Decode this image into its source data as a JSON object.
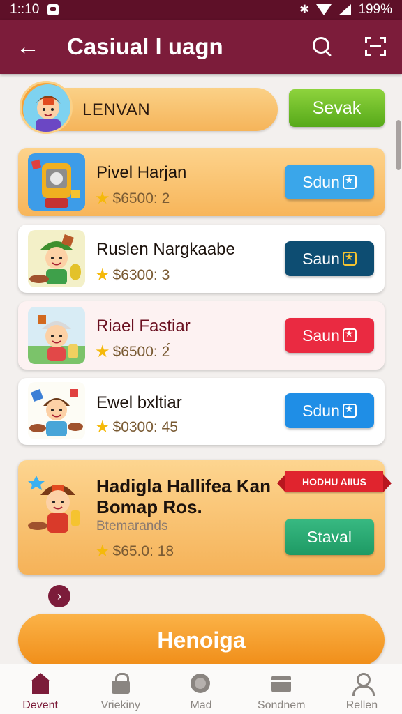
{
  "status_bar": {
    "time": "1::10",
    "battery": "199%"
  },
  "app_bar": {
    "title": "Casiual l uagn"
  },
  "profile": {
    "name": "LENVAN",
    "action_label": "Sevak"
  },
  "items": [
    {
      "name": "Pivel Harjan",
      "price": "$6500: 2",
      "button_label": "Sdun",
      "button_color": "#3aa6ea",
      "theme": "orange"
    },
    {
      "name": "Ruslen Nargkaabe",
      "price": "$6300: 3",
      "button_label": "Saun",
      "button_color": "#0d4d72",
      "theme": "white"
    },
    {
      "name": "Riael Fastiar",
      "price": "$6500: 2́",
      "button_label": "Saun",
      "button_color": "#ea2a41",
      "theme": "pink"
    },
    {
      "name": "Ewel bxltiar",
      "price": "$0300: 45",
      "button_label": "Sdun",
      "button_color": "#1f8ee6",
      "theme": "white"
    }
  ],
  "featured": {
    "ribbon": "HODHU AIIUS",
    "title_line1": "Hadigla Hallifea Kan",
    "title_line2": "Bomap Ros.",
    "subtitle": "Btemarands",
    "price": "$65.0: 18",
    "button_label": "Staval"
  },
  "main_button": {
    "label": "Henoiga"
  },
  "bottom_nav": [
    {
      "label": "Devent",
      "icon": "home-icon",
      "active": true
    },
    {
      "label": "Vriekiny",
      "icon": "lock-icon",
      "active": false
    },
    {
      "label": "Mad",
      "icon": "disc-icon",
      "active": false
    },
    {
      "label": "Sondnem",
      "icon": "box-icon",
      "active": false
    },
    {
      "label": "Rellen",
      "icon": "person-icon",
      "active": false
    }
  ],
  "colors": {
    "primary": "#7c1c3a",
    "status_bar": "#5e1028",
    "accent_orange": "#f5b258",
    "green": "#56a919"
  }
}
